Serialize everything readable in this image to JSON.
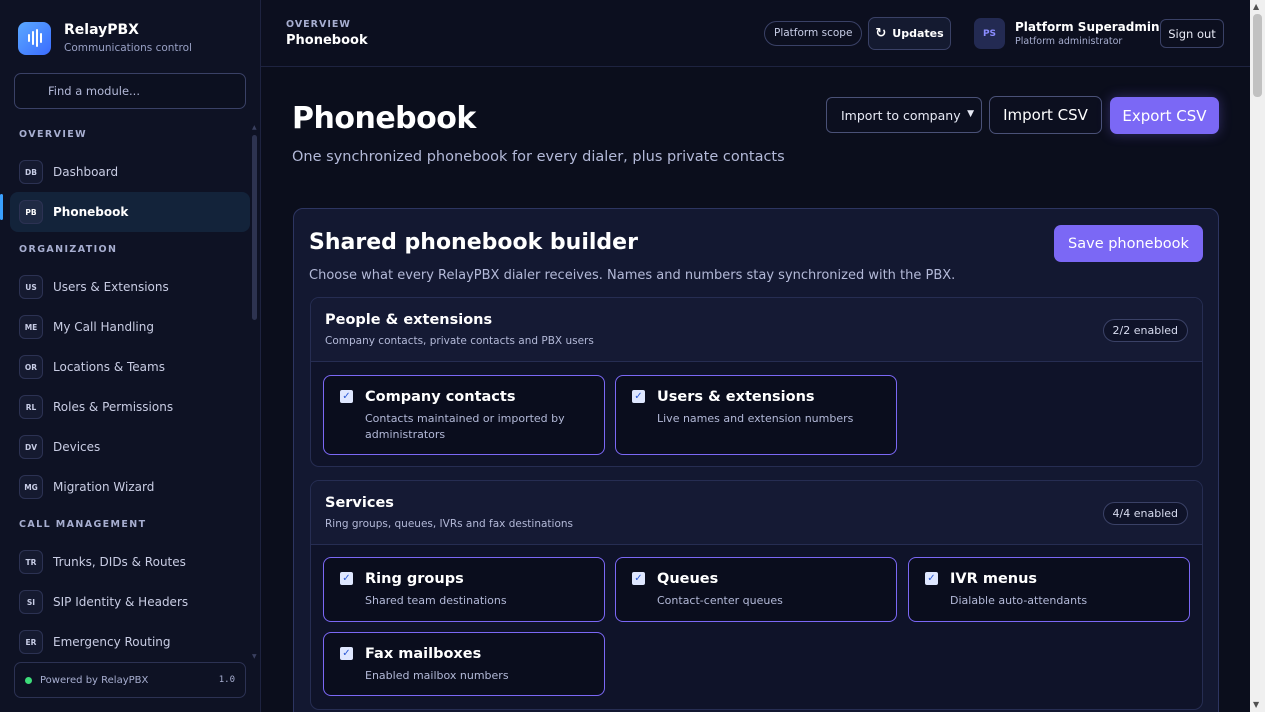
{
  "brand": {
    "name": "RelayPBX",
    "subtitle": "Communications control"
  },
  "search": {
    "placeholder": "Find a module..."
  },
  "nav": {
    "sections": [
      {
        "label": "OVERVIEW",
        "items": [
          {
            "code": "DB",
            "label": "Dashboard"
          },
          {
            "code": "PB",
            "label": "Phonebook",
            "active": true
          }
        ]
      },
      {
        "label": "ORGANIZATION",
        "items": [
          {
            "code": "US",
            "label": "Users & Extensions"
          },
          {
            "code": "ME",
            "label": "My Call Handling"
          },
          {
            "code": "OR",
            "label": "Locations & Teams"
          },
          {
            "code": "RL",
            "label": "Roles & Permissions"
          },
          {
            "code": "DV",
            "label": "Devices"
          },
          {
            "code": "MG",
            "label": "Migration Wizard"
          }
        ]
      },
      {
        "label": "CALL MANAGEMENT",
        "items": [
          {
            "code": "TR",
            "label": "Trunks, DIDs & Routes"
          },
          {
            "code": "SI",
            "label": "SIP Identity & Headers"
          },
          {
            "code": "ER",
            "label": "Emergency Routing"
          }
        ]
      }
    ]
  },
  "footer": {
    "powered": "Powered by RelayPBX",
    "version": "1.0",
    "status_color": "#3ddc7a"
  },
  "topbar": {
    "kicker": "OVERVIEW",
    "title": "Phonebook",
    "scope": "Platform scope",
    "updates": "Updates",
    "user": {
      "initials": "PS",
      "name": "Platform Superadmin",
      "role": "Platform administrator"
    },
    "signout": "Sign out"
  },
  "page": {
    "title": "Phonebook",
    "subtitle": "One synchronized phonebook for every dialer, plus private contacts",
    "import_select": "Import to company",
    "import_csv": "Import CSV",
    "export_csv": "Export CSV",
    "accent": "#7b68f5"
  },
  "builder": {
    "title": "Shared phonebook builder",
    "subtitle": "Choose what every RelayPBX dialer receives. Names and numbers stay synchronized with the PBX.",
    "save": "Save phonebook",
    "groups": [
      {
        "title": "People & extensions",
        "subtitle": "Company contacts, private contacts and PBX users",
        "count": "2/2 enabled",
        "options": [
          {
            "title": "Company contacts",
            "desc": "Contacts maintained or imported by administrators",
            "checked": true
          },
          {
            "title": "Users & extensions",
            "desc": "Live names and extension numbers",
            "checked": true
          }
        ]
      },
      {
        "title": "Services",
        "subtitle": "Ring groups, queues, IVRs and fax destinations",
        "count": "4/4 enabled",
        "options": [
          {
            "title": "Ring groups",
            "desc": "Shared team destinations",
            "checked": true
          },
          {
            "title": "Queues",
            "desc": "Contact-center queues",
            "checked": true
          },
          {
            "title": "IVR menus",
            "desc": "Dialable auto-attendants",
            "checked": true
          },
          {
            "title": "Fax mailboxes",
            "desc": "Enabled mailbox numbers",
            "checked": true
          }
        ]
      }
    ]
  }
}
